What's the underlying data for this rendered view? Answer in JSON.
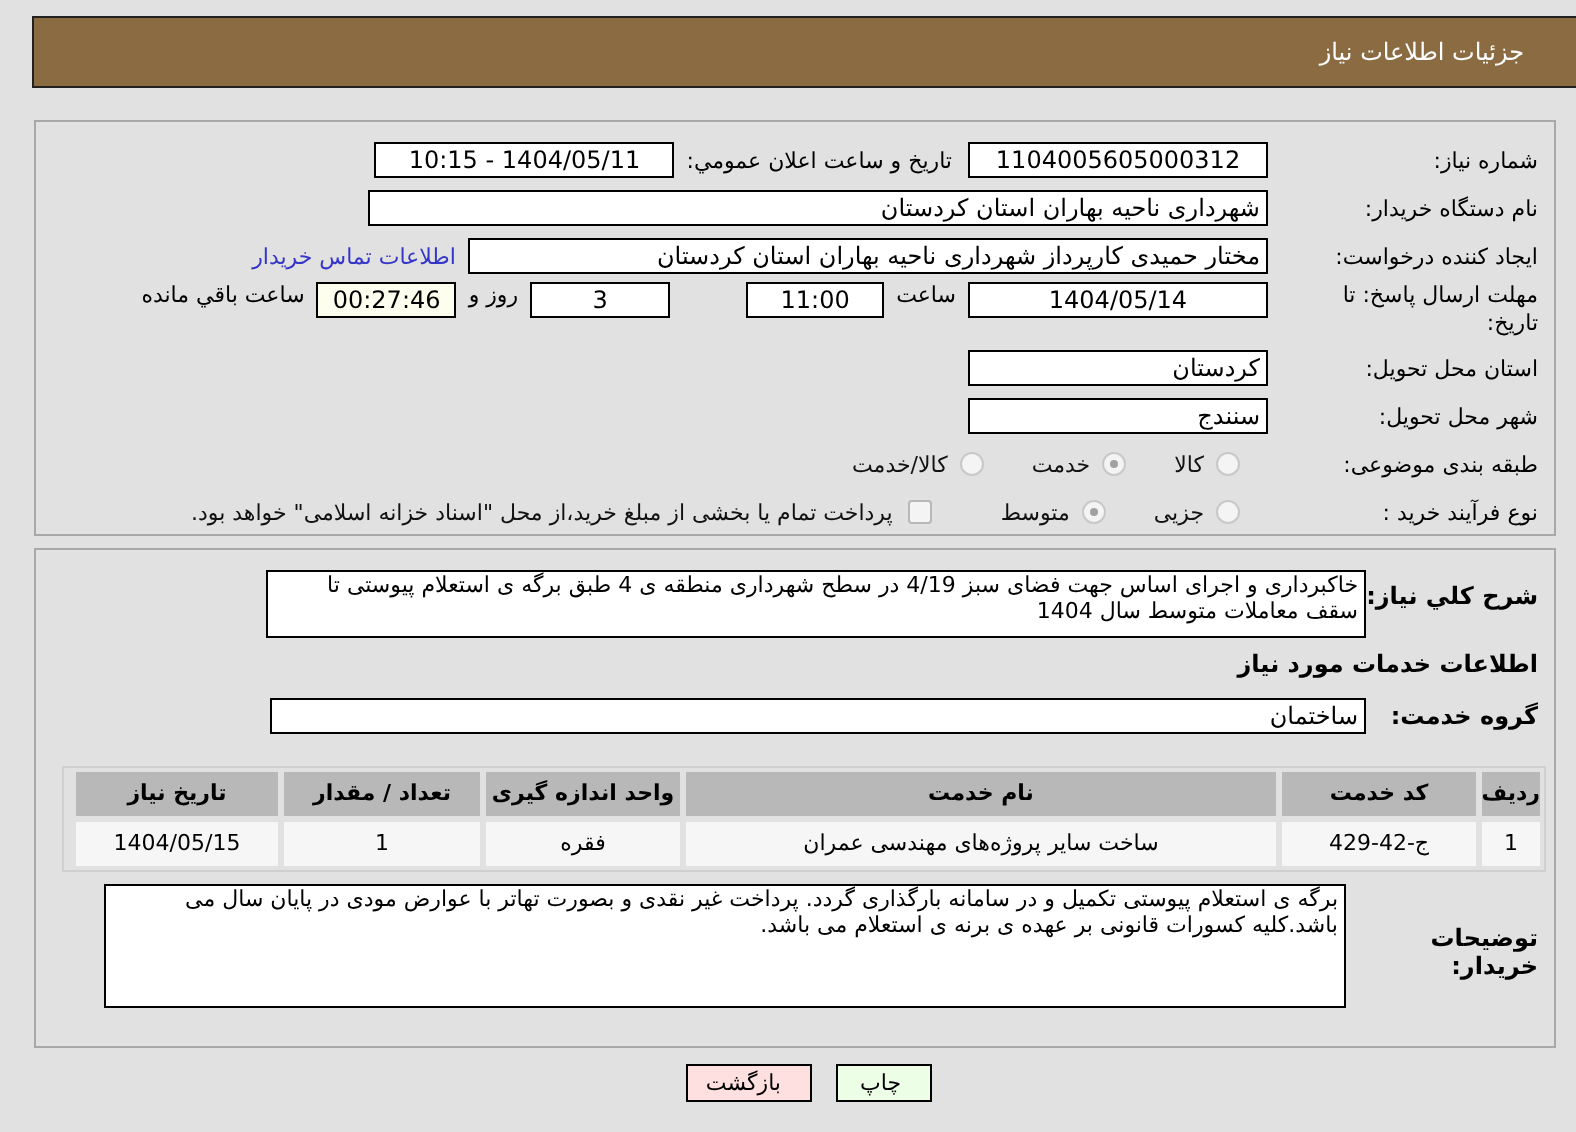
{
  "header": {
    "title": "جزئیات اطلاعات نیاز"
  },
  "details": {
    "need_number": {
      "label": "شماره نیاز:",
      "value": "1104005605000312"
    },
    "announce": {
      "label": "تاریخ و ساعت اعلان عمومي:",
      "value": "1404/05/11 - 10:15"
    },
    "buyer_org": {
      "label": "نام دستگاه خریدار:",
      "value": "شهرداری ناحیه بهاران استان کردستان"
    },
    "creator": {
      "label": "ایجاد کننده درخواست:",
      "value": "مختار حمیدی کارپرداز شهرداری ناحیه بهاران استان کردستان",
      "link": "اطلاعات تماس خریدار"
    },
    "deadline": {
      "label": "مهلت ارسال پاسخ: تا تاریخ:",
      "date": "1404/05/14",
      "time_label": "ساعت",
      "time": "11:00",
      "days": "3",
      "days_label": "روز و",
      "remaining": "00:27:46",
      "remaining_label": "ساعت باقي مانده"
    },
    "province": {
      "label": "استان محل تحویل:",
      "value": "کردستان"
    },
    "city": {
      "label": "شهر محل تحویل:",
      "value": "سنندج"
    },
    "category": {
      "label": "طبقه بندی موضوعی:",
      "options": [
        {
          "label": "کالا",
          "selected": false
        },
        {
          "label": "خدمت",
          "selected": true
        },
        {
          "label": "کالا/خدمت",
          "selected": false
        }
      ]
    },
    "process": {
      "label": "نوع فرآیند خرید :",
      "options": [
        {
          "label": "جزیی",
          "selected": false
        },
        {
          "label": "متوسط",
          "selected": true
        }
      ],
      "treasury": {
        "label": "پرداخت تمام یا بخشی از مبلغ خرید،از محل \"اسناد خزانه اسلامی\" خواهد بود.",
        "checked": false
      }
    }
  },
  "summary": {
    "label": "شرح کلي نیاز:",
    "value": "خاکبرداری و اجرای اساس جهت فضای سبز 4/19  در سطح شهرداری منطقه ی 4 طبق برگه ی استعلام پیوستی تا سقف معاملات متوسط سال 1404"
  },
  "services": {
    "heading": "اطلاعات خدمات مورد نیاز",
    "group": {
      "label": "گروه خدمت:",
      "value": "ساختمان"
    },
    "table": {
      "columns": [
        "ردیف",
        "کد خدمت",
        "نام خدمت",
        "واحد اندازه گیری",
        "تعداد / مقدار",
        "تاریخ نیاز"
      ],
      "rows": [
        [
          "1",
          "ج-42-429",
          "ساخت سایر پروژه‌های مهندسی عمران",
          "فقره",
          "1",
          "1404/05/15"
        ]
      ]
    }
  },
  "notes": {
    "label": "توضیحات خریدار:",
    "value": "برگه ی استعلام پیوستی تکمیل و در سامانه بارگذاری گردد. پرداخت غیر نقدی و بصورت تهاتر با عوارض مودی در پایان سال می باشد.کلیه کسورات قانونی بر عهده ی برنه ی استعلام می باشد."
  },
  "buttons": [
    {
      "label": "چاپ",
      "kind": "print"
    },
    {
      "label": "بازگشت",
      "kind": "back"
    }
  ]
}
